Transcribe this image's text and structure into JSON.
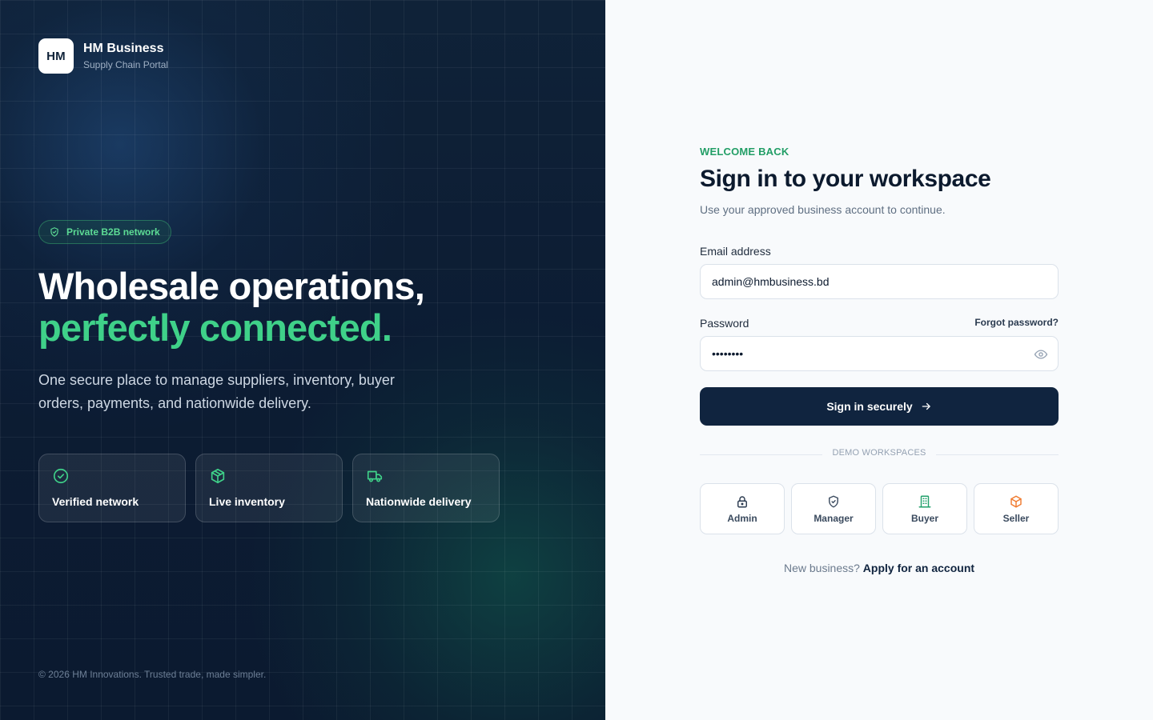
{
  "brand": {
    "logo_text": "HM",
    "name": "HM Business",
    "subtitle": "Supply Chain Portal"
  },
  "hero": {
    "badge": "Private B2B network",
    "headline_line1": "Wholesale operations,",
    "headline_line2": "perfectly connected.",
    "description": "One secure place to manage suppliers, inventory, buyer orders, payments, and nationwide delivery."
  },
  "features": [
    {
      "label": "Verified network",
      "icon": "check-circle-icon"
    },
    {
      "label": "Live inventory",
      "icon": "package-icon"
    },
    {
      "label": "Nationwide delivery",
      "icon": "truck-icon"
    }
  ],
  "footer": "© 2026 HM Innovations. Trusted trade, made simpler.",
  "form": {
    "eyebrow": "WELCOME BACK",
    "title": "Sign in to your workspace",
    "subtitle": "Use your approved business account to continue.",
    "email_label": "Email address",
    "email_value": "admin@hmbusiness.bd",
    "password_label": "Password",
    "forgot_link": "Forgot password?",
    "password_value": "••••••••",
    "submit_label": "Sign in securely",
    "divider_label": "DEMO WORKSPACES",
    "workspaces": [
      {
        "label": "Admin",
        "icon": "lock-icon"
      },
      {
        "label": "Manager",
        "icon": "shield-icon"
      },
      {
        "label": "Buyer",
        "icon": "building-icon"
      },
      {
        "label": "Seller",
        "icon": "box-icon"
      }
    ],
    "apply_prompt": "New business?",
    "apply_link": "Apply for an account"
  },
  "colors": {
    "accent_green": "#3fd189",
    "navy": "#10243f",
    "seller_orange": "#f07a2e"
  }
}
